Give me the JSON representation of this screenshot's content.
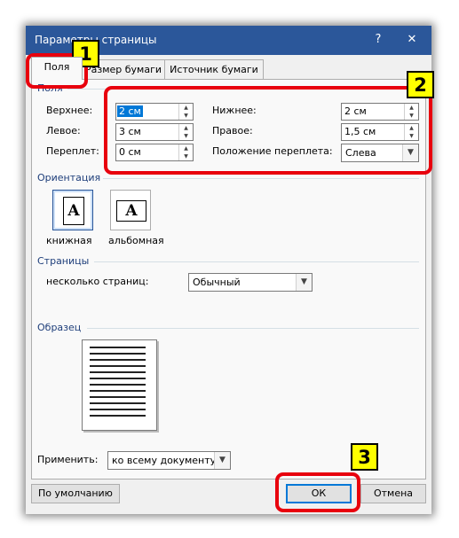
{
  "window": {
    "title": "Параметры страницы",
    "help_glyph": "?",
    "close_glyph": "✕",
    "help_icon": "question-icon",
    "close_icon": "close-icon"
  },
  "tabs": [
    {
      "label": "Поля",
      "active": true
    },
    {
      "label": "Размер бумаги",
      "active": false
    },
    {
      "label": "Источник бумаги",
      "active": false
    }
  ],
  "margins": {
    "group_label": "Поля",
    "top": {
      "label": "Верхнее:",
      "value": "2 см"
    },
    "bottom": {
      "label": "Нижнее:",
      "value": "2 см"
    },
    "left": {
      "label": "Левое:",
      "value": "3 см"
    },
    "right": {
      "label": "Правое:",
      "value": "1,5 см"
    },
    "gutter": {
      "label": "Переплет:",
      "value": "0 см"
    },
    "gutter_pos": {
      "label": "Положение переплета:",
      "value": "Слева"
    }
  },
  "orientation": {
    "group_label": "Ориентация",
    "portrait": {
      "label": "книжная",
      "glyph": "A",
      "selected": true
    },
    "landscape": {
      "label": "альбомная",
      "glyph": "A",
      "selected": false
    }
  },
  "pages": {
    "group_label": "Страницы",
    "multiple_label": "несколько страниц:",
    "multiple_value": "Обычный"
  },
  "sample": {
    "group_label": "Образец"
  },
  "apply": {
    "label": "Применить:",
    "value": "ко всему документу"
  },
  "buttons": {
    "default_label": "По умолчанию",
    "ok_label": "ОК",
    "cancel_label": "Отмена"
  },
  "annotations": {
    "badge1": "1",
    "badge2": "2",
    "badge3": "3",
    "color": "#e8000d",
    "badge_color": "#ffff00"
  },
  "colors": {
    "titlebar": "#2b579a",
    "selection": "#0078d7",
    "group_text": "#1e3e7a"
  }
}
